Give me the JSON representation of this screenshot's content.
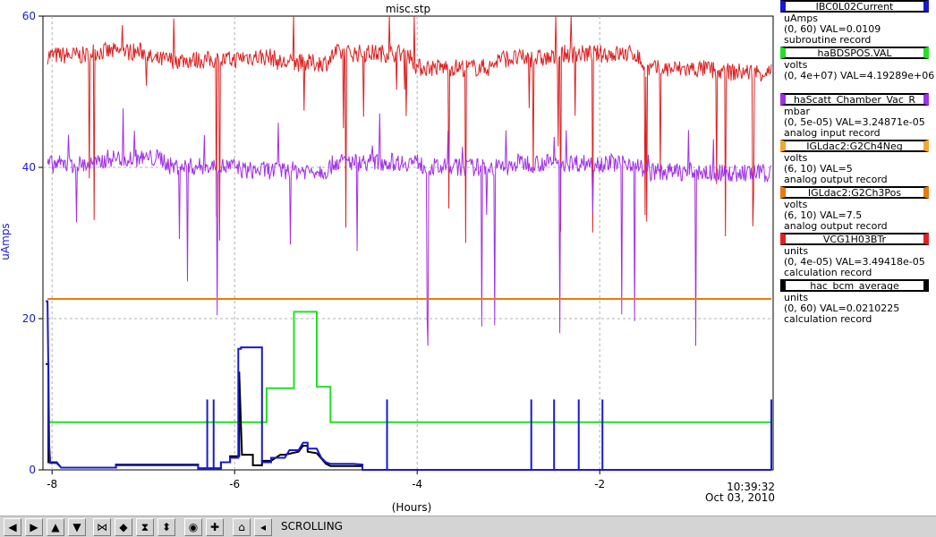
{
  "chart_data": {
    "type": "line",
    "title": "misc.stp",
    "ylabel": "uAmps",
    "xlabel": "(Hours)",
    "xlim": [
      -8.1,
      -0.1
    ],
    "ylim": [
      0,
      60
    ],
    "xticks": [
      -8,
      -6,
      -4,
      -2
    ],
    "xtick_labels": [
      "-8",
      "-6",
      "-4",
      "-2"
    ],
    "yticks": [
      0,
      20,
      40,
      60
    ],
    "ytick_labels": [
      "0",
      "20",
      "40",
      "60"
    ],
    "grid": true,
    "legend_position": "right",
    "end_time": "10:39:32",
    "end_date": "Oct 03, 2010",
    "series": [
      {
        "name": "VCG1H03BTr",
        "color": "#dd2222",
        "kind": "noisy",
        "x": [
          -8.05,
          -7.6,
          -7.55,
          -7.0,
          -6.9,
          -6.0,
          -5.9,
          -5.6,
          -5.5,
          -5.0,
          -4.9,
          -4.1,
          -4.0,
          -3.2,
          -3.1,
          -2.5,
          -2.4,
          -1.6,
          -1.5,
          -0.8,
          -0.7,
          -0.12
        ],
        "y": [
          54.8,
          54.8,
          55.3,
          55.3,
          54.2,
          54.2,
          54.6,
          54.6,
          53.8,
          53.8,
          55.1,
          55.1,
          53.2,
          53.2,
          54.4,
          54.4,
          55.0,
          55.0,
          53.0,
          53.0,
          52.6,
          52.6
        ]
      },
      {
        "name": "haScatt_Chamber_Vac_R",
        "color": "#a030e8",
        "kind": "noisy",
        "x": [
          -8.05,
          -7.5,
          -7.4,
          -6.8,
          -6.7,
          -6.0,
          -5.9,
          -5.0,
          -4.9,
          -4.0,
          -3.9,
          -3.0,
          -2.9,
          -1.6,
          -1.5,
          -0.9,
          -0.8,
          -0.12
        ],
        "y": [
          40.4,
          40.4,
          41.2,
          41.2,
          40.1,
          40.1,
          39.6,
          39.6,
          40.7,
          40.7,
          40.0,
          40.0,
          40.6,
          40.6,
          39.4,
          39.4,
          39.2,
          39.2
        ]
      },
      {
        "name": "IGLdac2:G2Ch3Pos",
        "color": "#e87a10",
        "kind": "line",
        "x": [
          -8.05,
          -0.12
        ],
        "y": [
          22.6,
          22.6
        ]
      },
      {
        "name": "haBDSPOS.VAL",
        "color": "#22e022",
        "kind": "line",
        "x": [
          -8.05,
          -5.65,
          -5.65,
          -5.35,
          -5.35,
          -5.3,
          -5.1,
          -5.1,
          -4.95,
          -4.95,
          -0.12
        ],
        "y": [
          6.3,
          6.3,
          10.8,
          10.8,
          20.9,
          20.9,
          20.9,
          11.0,
          11.0,
          6.3,
          6.3
        ]
      },
      {
        "name": "hac_bcm_average",
        "color": "#000000",
        "kind": "line",
        "x": [
          -8.07,
          -8.04,
          -8.04,
          -7.95,
          -7.9,
          -7.3,
          -7.3,
          -6.4,
          -6.4,
          -6.15,
          -6.15,
          -6.05,
          -6.05,
          -5.95,
          -5.95,
          -5.92,
          -5.8,
          -5.8,
          -5.7,
          -5.7,
          -5.6,
          -5.5,
          -5.45,
          -5.3,
          -5.25,
          -5.2,
          -5.2,
          -5.1,
          -5.0,
          -4.95,
          -4.6,
          -4.6,
          -0.12
        ],
        "y": [
          14.0,
          14.0,
          1.0,
          1.0,
          0.3,
          0.3,
          0.7,
          0.7,
          0.2,
          0.2,
          1.0,
          1.0,
          1.8,
          1.8,
          13.0,
          2.0,
          2.0,
          0.6,
          0.6,
          1.2,
          1.2,
          2.0,
          2.0,
          2.4,
          3.2,
          3.2,
          2.4,
          2.2,
          0.8,
          0.5,
          0.5,
          0.0,
          0.0
        ]
      },
      {
        "name": "IBC0L02Current",
        "color": "#1a1acc",
        "kind": "line",
        "x": [
          -8.07,
          -8.05,
          -8.03,
          -8.02,
          -7.95,
          -7.9,
          -7.3,
          -7.3,
          -6.4,
          -6.4,
          -6.15,
          -6.15,
          -6.05,
          -6.05,
          -5.96,
          -5.96,
          -5.93,
          -5.93,
          -5.7,
          -5.7,
          -5.6,
          -5.6,
          -5.45,
          -5.4,
          -5.3,
          -5.25,
          -5.2,
          -5.2,
          -5.1,
          -5.05,
          -5.0,
          -4.95,
          -4.7,
          -4.6,
          -4.6,
          -0.12
        ],
        "y": [
          22.3,
          22.3,
          3.0,
          0.9,
          0.9,
          0.3,
          0.3,
          0.6,
          0.6,
          0.2,
          0.2,
          1.0,
          1.0,
          1.6,
          1.6,
          16.0,
          16.0,
          16.2,
          16.2,
          1.0,
          1.0,
          1.6,
          1.6,
          2.6,
          2.6,
          3.6,
          3.6,
          2.8,
          2.8,
          1.6,
          1.0,
          0.8,
          0.8,
          0.7,
          0.0,
          0.0
        ]
      }
    ],
    "spikes": [
      {
        "series": "IBC0L02Current",
        "x": [
          -6.3,
          -6.23,
          -4.33,
          -2.75,
          -2.5,
          -2.23,
          -1.97,
          -0.12
        ],
        "y": [
          9.3,
          9.3,
          9.3,
          9.3,
          9.3,
          9.3,
          9.3,
          9.3
        ]
      }
    ]
  },
  "legend": {
    "entries": [
      {
        "name": "IBC0L02Current",
        "color": "#1a1acc",
        "unit": "uAmps",
        "range": "(0, 60) VAL=0.0109",
        "record": "subroutine record"
      },
      {
        "name": "haBDSPOS.VAL",
        "color": "#22e022",
        "unit": "volts",
        "range": "(0, 4e+07) VAL=4.19289e+06",
        "record": ""
      },
      {
        "name": "haScatt_Chamber_Vac_R",
        "color": "#a030e8",
        "unit": "mbar",
        "range": "(0, 5e-05) VAL=3.24871e-05",
        "record": "analog input record"
      },
      {
        "name": "IGLdac2:G2Ch4Neg",
        "color": "#f0a830",
        "unit": "volts",
        "range": "(6, 10) VAL=5",
        "record": "analog output record"
      },
      {
        "name": "IGLdac2:G2Ch3Pos",
        "color": "#e87a10",
        "unit": "volts",
        "range": "(6, 10) VAL=7.5",
        "record": "analog output record"
      },
      {
        "name": "VCG1H03BTr",
        "color": "#dd2222",
        "unit": "units",
        "range": "(0, 4e-05) VAL=3.49418e-05",
        "record": "calculation record"
      },
      {
        "name": "hac_bcm_average",
        "color": "#000000",
        "unit": "units",
        "range": "(0, 60) VAL=0.0210225",
        "record": "calculation record"
      }
    ]
  },
  "toolbar": {
    "buttons": [
      {
        "name": "scroll-left-button",
        "icon": "arrow-left-icon",
        "glyph": "◀"
      },
      {
        "name": "scroll-right-button",
        "icon": "arrow-right-icon",
        "glyph": "▶"
      },
      {
        "name": "scroll-up-button",
        "icon": "arrow-up-icon",
        "glyph": "▲"
      },
      {
        "name": "scroll-down-button",
        "icon": "arrow-down-icon",
        "glyph": "▼"
      },
      {
        "name": "zoom-in-x-button",
        "icon": "zoom-in-x-icon",
        "glyph": "⋈"
      },
      {
        "name": "zoom-out-x-button",
        "icon": "zoom-out-x-icon",
        "glyph": "◆"
      },
      {
        "name": "zoom-in-y-button",
        "icon": "zoom-in-y-icon",
        "glyph": "⧗"
      },
      {
        "name": "zoom-out-y-button",
        "icon": "zoom-out-y-icon",
        "glyph": "⬍"
      },
      {
        "name": "auto-scale-button",
        "icon": "target-icon",
        "glyph": "◉"
      },
      {
        "name": "add-pv-button",
        "icon": "plus-icon",
        "glyph": "✚"
      },
      {
        "name": "toggle-scrolling-button",
        "icon": "scrolling-icon",
        "glyph": "⌂"
      },
      {
        "name": "undo-button",
        "icon": "undo-icon",
        "glyph": "◂"
      }
    ],
    "status": "SCROLLING"
  }
}
